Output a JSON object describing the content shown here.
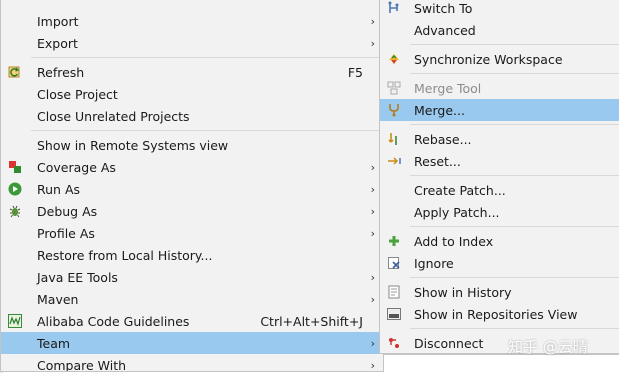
{
  "main_menu": {
    "import": "Import",
    "export": "Export",
    "refresh": "Refresh",
    "refresh_shortcut": "F5",
    "close_project": "Close Project",
    "close_unrelated": "Close Unrelated Projects",
    "show_remote": "Show in Remote Systems view",
    "coverage_as": "Coverage As",
    "run_as": "Run As",
    "debug_as": "Debug As",
    "profile_as": "Profile As",
    "restore_history": "Restore from Local History...",
    "java_ee_tools": "Java EE Tools",
    "maven": "Maven",
    "alibaba": "Alibaba Code Guidelines",
    "alibaba_shortcut": "Ctrl+Alt+Shift+J",
    "team": "Team",
    "compare_with": "Compare With"
  },
  "team_menu": {
    "switch_to": "Switch To",
    "advanced": "Advanced",
    "synchronize": "Synchronize Workspace",
    "merge_tool": "Merge Tool",
    "merge": "Merge...",
    "rebase": "Rebase...",
    "reset": "Reset...",
    "create_patch": "Create Patch...",
    "apply_patch": "Apply Patch...",
    "add_to_index": "Add to Index",
    "ignore": "Ignore",
    "show_history": "Show in History",
    "show_repos": "Show in Repositories View",
    "disconnect": "Disconnect"
  },
  "submenu_arrow": "›",
  "watermark": "知乎 @云晴",
  "colors": {
    "menu_bg": "#f2f2f2",
    "highlight": "#99c9ef",
    "disabled": "#8c8c8c"
  }
}
